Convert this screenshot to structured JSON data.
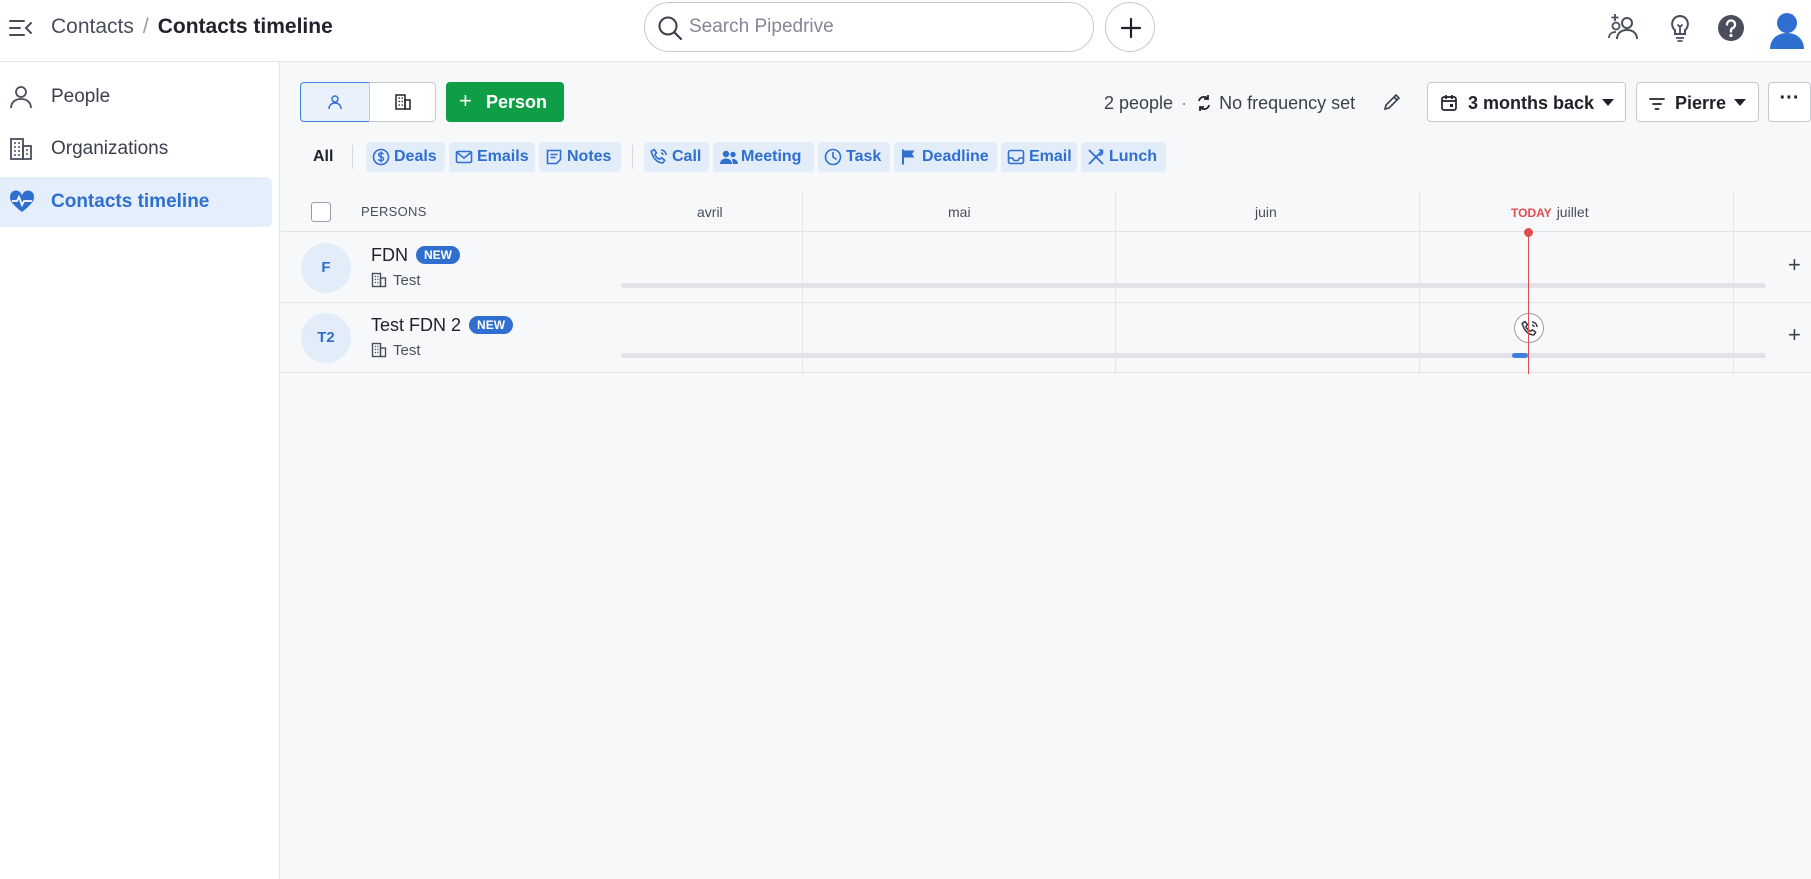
{
  "header": {
    "breadcrumb_parent": "Contacts",
    "breadcrumb_sep": "/",
    "breadcrumb_current": "Contacts timeline",
    "search_placeholder": "Search Pipedrive"
  },
  "sidebar": {
    "items": [
      {
        "label": "People",
        "icon": "person-icon"
      },
      {
        "label": "Organizations",
        "icon": "building-icon"
      },
      {
        "label": "Contacts timeline",
        "icon": "heart-pulse-icon",
        "active": true
      }
    ]
  },
  "toolbar": {
    "add_person_label": "Person",
    "people_count": "2 people",
    "frequency": "No frequency set",
    "period": "3 months back",
    "filter": "Pierre",
    "more": "···"
  },
  "filters": {
    "all": "All",
    "chips": [
      "Deals",
      "Emails",
      "Notes",
      "Call",
      "Meeting",
      "Task",
      "Deadline",
      "Email",
      "Lunch"
    ]
  },
  "timeline": {
    "persons_header": "PERSONS",
    "months": [
      "avril",
      "mai",
      "juin",
      "juillet"
    ],
    "today_label": "TODAY",
    "rows": [
      {
        "initials": "F",
        "name": "FDN",
        "badge": "NEW",
        "org": "Test"
      },
      {
        "initials": "T2",
        "name": "Test FDN 2",
        "badge": "NEW",
        "org": "Test"
      }
    ]
  },
  "colors": {
    "accent": "#2f6fd0",
    "add_button": "#0f9d46",
    "today": "#e04d4d"
  }
}
